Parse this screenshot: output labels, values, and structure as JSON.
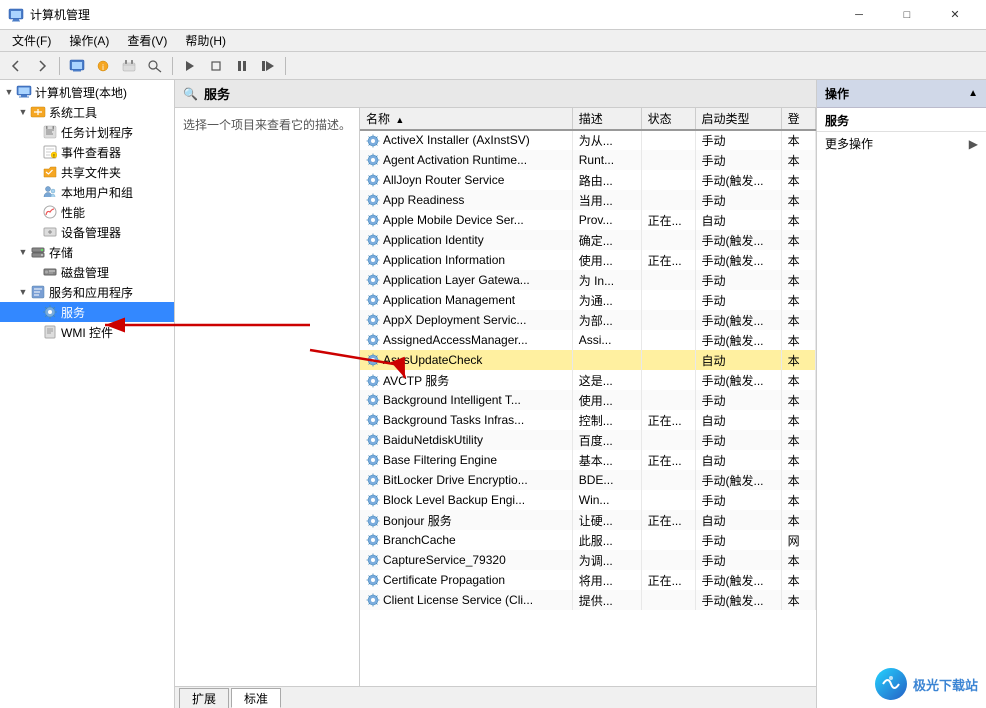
{
  "window": {
    "title": "计算机管理",
    "minimize": "─",
    "maximize": "□",
    "close": "✕"
  },
  "menubar": {
    "items": [
      "文件(F)",
      "操作(A)",
      "查看(V)",
      "帮助(H)"
    ]
  },
  "sidebar": {
    "root_label": "计算机管理(本地)",
    "sections": [
      {
        "label": "系统工具",
        "indent": 1,
        "expanded": true
      },
      {
        "label": "任务计划程序",
        "indent": 2
      },
      {
        "label": "事件查看器",
        "indent": 2
      },
      {
        "label": "共享文件夹",
        "indent": 2
      },
      {
        "label": "本地用户和组",
        "indent": 2
      },
      {
        "label": "性能",
        "indent": 2
      },
      {
        "label": "设备管理器",
        "indent": 2
      },
      {
        "label": "存储",
        "indent": 1
      },
      {
        "label": "磁盘管理",
        "indent": 2
      },
      {
        "label": "服务和应用程序",
        "indent": 1,
        "expanded": true
      },
      {
        "label": "服务",
        "indent": 2,
        "selected": true
      },
      {
        "label": "WMI 控件",
        "indent": 2
      }
    ]
  },
  "services_panel": {
    "header": "服务",
    "description_placeholder": "选择一个项目来查看它的描述。"
  },
  "table": {
    "columns": [
      "名称",
      "描述",
      "状态",
      "启动类型",
      "登"
    ],
    "rows": [
      {
        "name": "ActiveX Installer (AxInstSV)",
        "desc": "为从...",
        "status": "",
        "startup": "手动",
        "logon": "本"
      },
      {
        "name": "Agent Activation Runtime...",
        "desc": "Runt...",
        "status": "",
        "startup": "手动",
        "logon": "本"
      },
      {
        "name": "AllJoyn Router Service",
        "desc": "路由...",
        "status": "",
        "startup": "手动(触发...",
        "logon": "本"
      },
      {
        "name": "App Readiness",
        "desc": "当用...",
        "status": "",
        "startup": "手动",
        "logon": "本"
      },
      {
        "name": "Apple Mobile Device Ser...",
        "desc": "Prov...",
        "status": "正在...",
        "startup": "自动",
        "logon": "本"
      },
      {
        "name": "Application Identity",
        "desc": "确定...",
        "status": "",
        "startup": "手动(触发...",
        "logon": "本"
      },
      {
        "name": "Application Information",
        "desc": "使用...",
        "status": "正在...",
        "startup": "手动(触发...",
        "logon": "本"
      },
      {
        "name": "Application Layer Gatewa...",
        "desc": "为 In...",
        "status": "",
        "startup": "手动",
        "logon": "本"
      },
      {
        "name": "Application Management",
        "desc": "为通...",
        "status": "",
        "startup": "手动",
        "logon": "本"
      },
      {
        "name": "AppX Deployment Servic...",
        "desc": "为部...",
        "status": "",
        "startup": "手动(触发...",
        "logon": "本"
      },
      {
        "name": "AssignedAccessManager...",
        "desc": "Assi...",
        "status": "",
        "startup": "手动(触发...",
        "logon": "本"
      },
      {
        "name": "AsusUpdateCheck",
        "desc": "",
        "status": "",
        "startup": "自动",
        "logon": "本"
      },
      {
        "name": "AVCTP 服务",
        "desc": "这是...",
        "status": "",
        "startup": "手动(触发...",
        "logon": "本"
      },
      {
        "name": "Background Intelligent T...",
        "desc": "使用...",
        "status": "",
        "startup": "手动",
        "logon": "本"
      },
      {
        "name": "Background Tasks Infras...",
        "desc": "控制...",
        "status": "正在...",
        "startup": "自动",
        "logon": "本"
      },
      {
        "name": "BaiduNetdiskUtility",
        "desc": "百度...",
        "status": "",
        "startup": "手动",
        "logon": "本"
      },
      {
        "name": "Base Filtering Engine",
        "desc": "基本...",
        "status": "正在...",
        "startup": "自动",
        "logon": "本"
      },
      {
        "name": "BitLocker Drive Encryptio...",
        "desc": "BDE...",
        "status": "",
        "startup": "手动(触发...",
        "logon": "本"
      },
      {
        "name": "Block Level Backup Engi...",
        "desc": "Win...",
        "status": "",
        "startup": "手动",
        "logon": "本"
      },
      {
        "name": "Bonjour 服务",
        "desc": "让硬...",
        "status": "正在...",
        "startup": "自动",
        "logon": "本"
      },
      {
        "name": "BranchCache",
        "desc": "此服...",
        "status": "",
        "startup": "手动",
        "logon": "网"
      },
      {
        "name": "CaptureService_79320",
        "desc": "为调...",
        "status": "",
        "startup": "手动",
        "logon": "本"
      },
      {
        "name": "Certificate Propagation",
        "desc": "将用...",
        "status": "正在...",
        "startup": "手动(触发...",
        "logon": "本"
      },
      {
        "name": "Client License Service (Cli...",
        "desc": "提供...",
        "status": "",
        "startup": "手动(触发...",
        "logon": "本"
      }
    ]
  },
  "bottom_tabs": [
    "扩展",
    "标准"
  ],
  "action_pane": {
    "header": "操作",
    "section1": "服务",
    "section1_items": [
      "更多操作"
    ],
    "arrow_right": "▶"
  },
  "watermark": {
    "text": "极光下载站",
    "url": "www.xz7.com"
  }
}
